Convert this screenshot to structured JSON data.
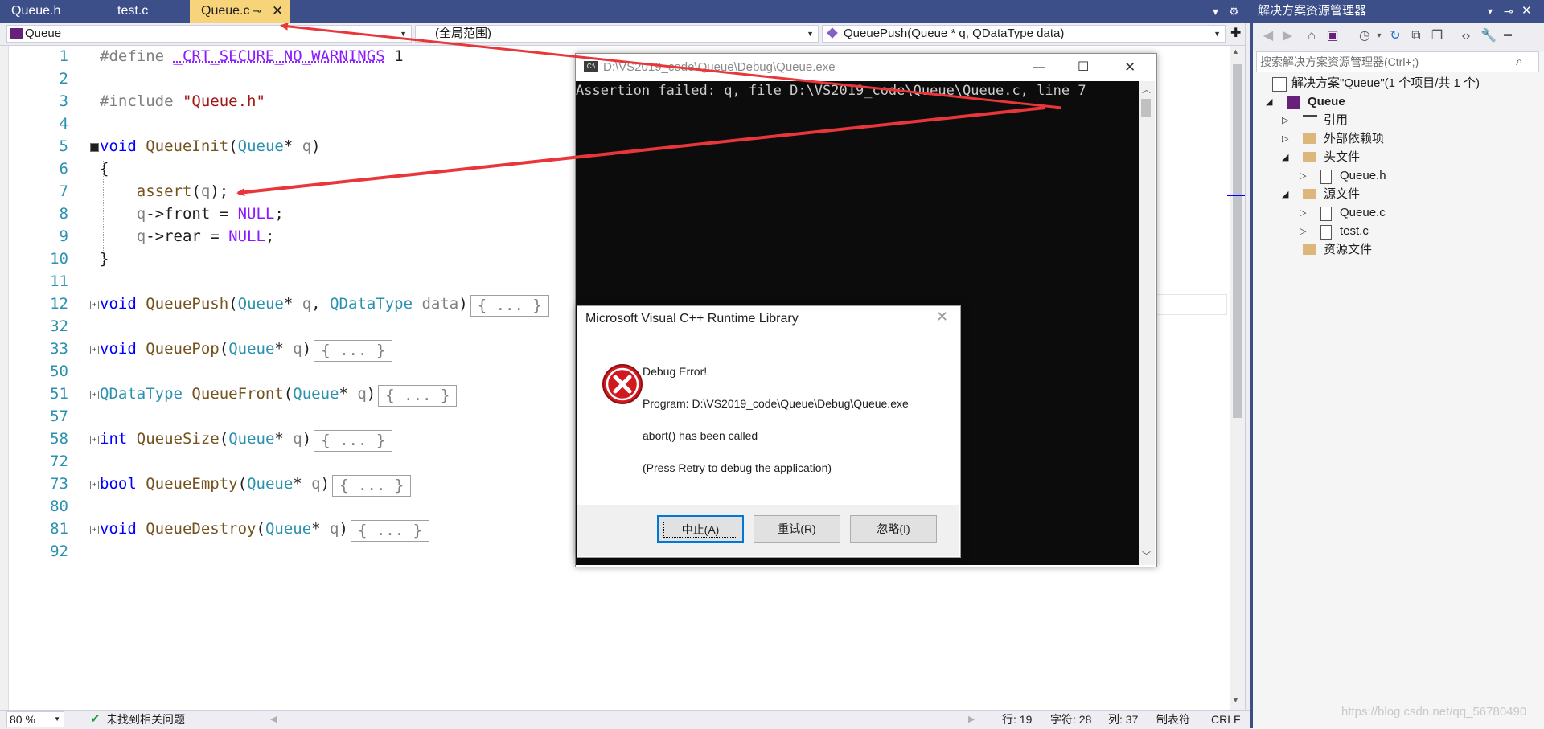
{
  "tabs": [
    {
      "label": "Queue.h",
      "active": false
    },
    {
      "label": "test.c",
      "active": false
    },
    {
      "label": "Queue.c",
      "active": true
    }
  ],
  "nav": {
    "project": "Queue",
    "scope": "(全局范围)",
    "member": "QueuePush(Queue * q, QDataType data)"
  },
  "code_lines": [
    {
      "num": "1",
      "text": "#define _CRT_SECURE_NO_WARNINGS 1"
    },
    {
      "num": "2",
      "text": ""
    },
    {
      "num": "3",
      "text": "#include \"Queue.h\""
    },
    {
      "num": "4",
      "text": ""
    },
    {
      "num": "5",
      "text": "void QueueInit(Queue* q)"
    },
    {
      "num": "6",
      "text": "{"
    },
    {
      "num": "7",
      "text": "    assert(q);"
    },
    {
      "num": "8",
      "text": "    q->front = NULL;"
    },
    {
      "num": "9",
      "text": "    q->rear = NULL;"
    },
    {
      "num": "10",
      "text": "}"
    },
    {
      "num": "11",
      "text": ""
    },
    {
      "num": "12",
      "text": "void QueuePush(Queue* q, QDataType data)"
    },
    {
      "num": "32",
      "text": ""
    },
    {
      "num": "33",
      "text": "void QueuePop(Queue* q)"
    },
    {
      "num": "50",
      "text": ""
    },
    {
      "num": "51",
      "text": "QDataType QueueFront(Queue* q)"
    },
    {
      "num": "57",
      "text": ""
    },
    {
      "num": "58",
      "text": "int QueueSize(Queue* q)"
    },
    {
      "num": "72",
      "text": ""
    },
    {
      "num": "73",
      "text": "bool QueueEmpty(Queue* q)"
    },
    {
      "num": "80",
      "text": ""
    },
    {
      "num": "81",
      "text": "void QueueDestroy(Queue* q)"
    },
    {
      "num": "92",
      "text": ""
    }
  ],
  "collapsed_label": "{ ... }",
  "status": {
    "zoom": "80 %",
    "issues": "未找到相关问题",
    "line": "行: 19",
    "char": "字符: 28",
    "col": "列: 37",
    "tabs": "制表符",
    "eol": "CRLF"
  },
  "solution_explorer": {
    "title": "解决方案资源管理器",
    "search_placeholder": "搜索解决方案资源管理器(Ctrl+;)",
    "items": [
      {
        "label": "解决方案\"Queue\"(1 个项目/共 1 个)",
        "level": 0,
        "icon": "solution-icon"
      },
      {
        "label": "Queue",
        "level": 1,
        "icon": "project-icon",
        "bold": true
      },
      {
        "label": "引用",
        "level": 2,
        "icon": "references-icon"
      },
      {
        "label": "外部依赖项",
        "level": 2,
        "icon": "folder-icon"
      },
      {
        "label": "头文件",
        "level": 2,
        "icon": "folder-icon"
      },
      {
        "label": "Queue.h",
        "level": 3,
        "icon": "file-h-icon"
      },
      {
        "label": "源文件",
        "level": 2,
        "icon": "folder-icon"
      },
      {
        "label": "Queue.c",
        "level": 3,
        "icon": "file-c-icon"
      },
      {
        "label": "test.c",
        "level": 3,
        "icon": "file-c-icon"
      },
      {
        "label": "资源文件",
        "level": 2,
        "icon": "folder-icon"
      }
    ]
  },
  "console": {
    "title": "D:\\VS2019_code\\Queue\\Debug\\Queue.exe",
    "output": "Assertion failed: q, file D:\\VS2019_code\\Queue\\Queue.c, line 7"
  },
  "dialog": {
    "title": "Microsoft Visual C++ Runtime Library",
    "heading": "Debug Error!",
    "program": "Program: D:\\VS2019_code\\Queue\\Debug\\Queue.exe",
    "message": "abort() has been called",
    "hint": "(Press Retry to debug the application)",
    "buttons": [
      "中止(A)",
      "重试(R)",
      "忽略(I)"
    ]
  },
  "watermark": "https://blog.csdn.net/qq_56780490",
  "colors": {
    "tab_bar": "#3d4f89",
    "active_tab": "#f7d37a",
    "arrow": "#e8363a",
    "error_icon": "#d11a1f"
  }
}
